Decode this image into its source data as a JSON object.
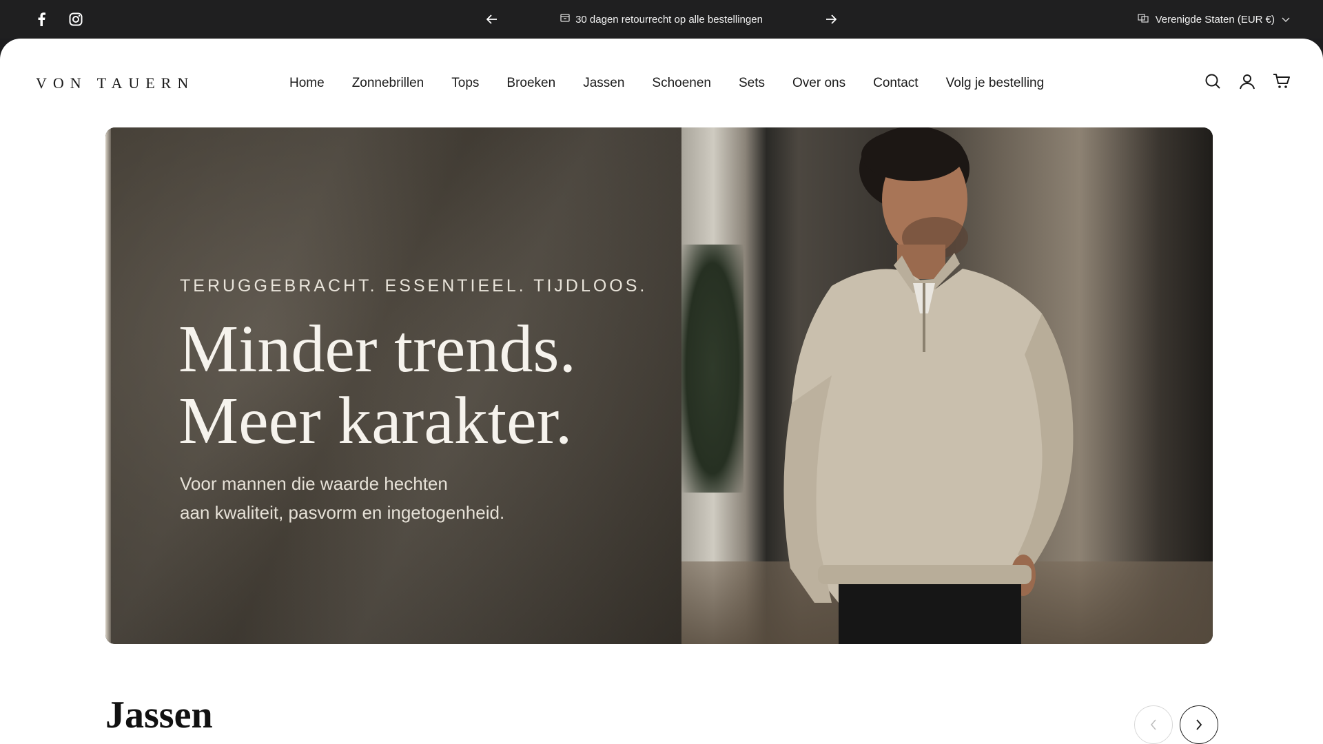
{
  "announcement": {
    "message": "30 dagen retourrecht op alle bestellingen",
    "country": "Verenigde Staten (EUR €)",
    "icons": [
      "facebook-icon",
      "instagram-icon",
      "arrow-left-icon",
      "arrow-right-icon",
      "return-box-icon",
      "globe-icon",
      "chevron-down-icon"
    ]
  },
  "header": {
    "logo": "VON TAUERN",
    "nav": [
      "Home",
      "Zonnebrillen",
      "Tops",
      "Broeken",
      "Jassen",
      "Schoenen",
      "Sets",
      "Over ons",
      "Contact",
      "Volg je bestelling"
    ],
    "icons": [
      "search-icon",
      "account-icon",
      "cart-icon"
    ]
  },
  "hero": {
    "eyebrow": "TERUGGEBRACHT. ESSENTIEEL. TIJDLOOS.",
    "headline_line1": "Minder trends.",
    "headline_line2": "Meer karakter.",
    "sub_line1": "Voor mannen die waarde hechten",
    "sub_line2": "aan kwaliteit, pasvorm en ingetogenheid."
  },
  "section": {
    "title": "Jassen"
  },
  "colors": {
    "topbar": "#1f1f20",
    "page": "#ffffff",
    "text": "#1a1a1a"
  }
}
